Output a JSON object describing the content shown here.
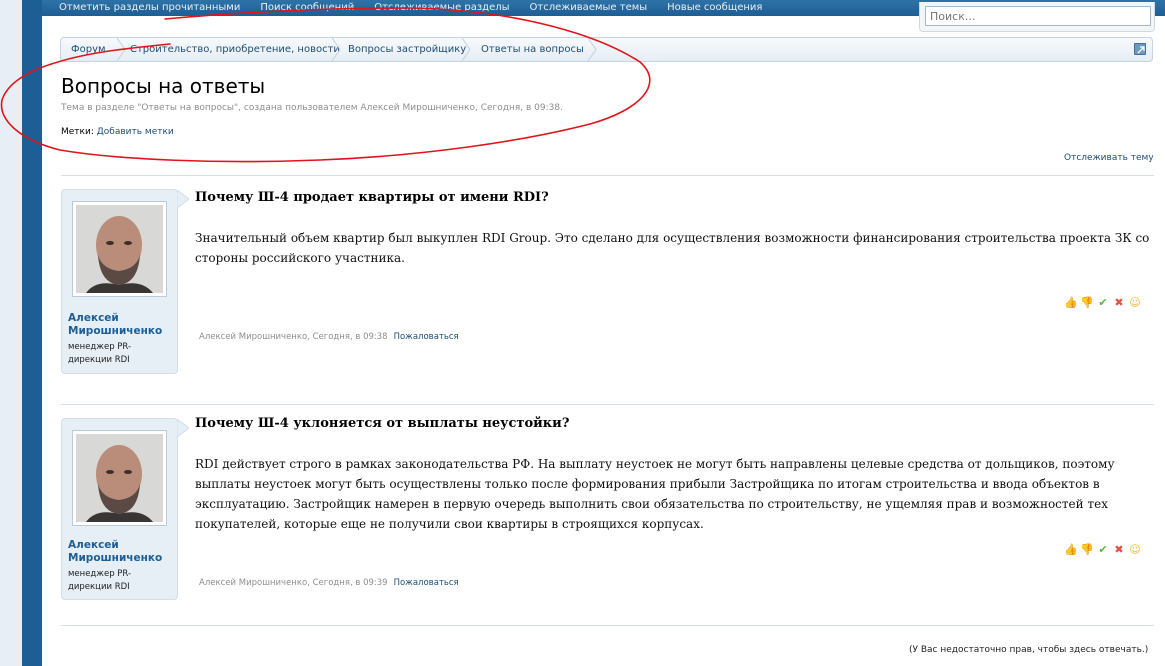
{
  "topnav": {
    "links": [
      "Отметить разделы прочитанными",
      "Поиск сообщений",
      "Отслеживаемые разделы",
      "Отслеживаемые темы",
      "Новые сообщения"
    ]
  },
  "search": {
    "placeholder": "Поиск..."
  },
  "breadcrumb": [
    "Форум",
    "Строительство, приобретение, новости",
    "Вопросы застройщику",
    "Ответы на вопросы"
  ],
  "thread": {
    "title": "Вопросы на ответы",
    "description": "Тема в разделе \"Ответы на вопросы\", создана пользователем Алексей Мирошниченко, Сегодня, в 09:38.",
    "tags_label": "Метки:",
    "add_tags": "Добавить метки",
    "watch": "Отслеживать тему"
  },
  "posts": [
    {
      "author_line1": "Алексей",
      "author_line2": "Мирошниченко",
      "role_line1": "менеджер PR-",
      "role_line2": "дирекции RDI",
      "title": "Почему Ш-4 продает квартиры от имени RDI?",
      "body": "Значительный объем квартир был выкуплен RDI Group. Это сделано для осуществления возможности финансирования строительства проекта ЗК со стороны российского участника.",
      "meta": "Алексей Мирошниченко, Сегодня, в 09:38",
      "report": "Пожаловаться"
    },
    {
      "author_line1": "Алексей",
      "author_line2": "Мирошниченко",
      "role_line1": "менеджер PR-",
      "role_line2": "дирекции RDI",
      "title": "Почему Ш-4 уклоняется от выплаты неустойки?",
      "body": "RDI действует строго в рамках законодательства РФ. На выплату неустоек не могут быть направлены целевые средства от дольщиков, поэтому выплаты неустоек могут быть осуществлены только после формирования прибыли Застройщика по итогам строительства и ввода объектов в эксплуатацию. Застройщик намерен в первую очередь выполнить свои обязательства по строительству, не ущемляя прав и возможностей тех покупателей, которые еще не получили свои квартиры в строящихся корпусах.",
      "meta": "Алексей Мирошниченко, Сегодня, в 09:39",
      "report": "Пожаловаться"
    }
  ],
  "footer": {
    "no_reply": "(У Вас недостаточно прав, чтобы здесь отвечать.)"
  },
  "colors": {
    "nav": "#1d5e94",
    "link": "#1d4d78",
    "card": "#e6eef6",
    "annotation": "#e0141b"
  },
  "icons": [
    "external-link-icon",
    "like-icon",
    "dislike-icon",
    "agree-icon",
    "disagree-icon",
    "funny-icon"
  ]
}
